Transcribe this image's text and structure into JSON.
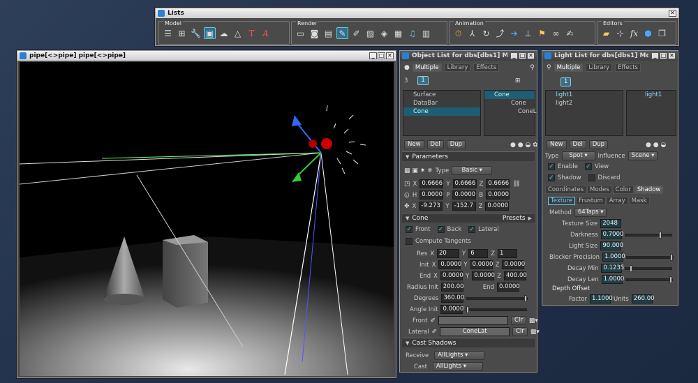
{
  "lists_window": {
    "title": "Lists",
    "close": "✕",
    "groups": [
      {
        "label": "Model",
        "icons": [
          "menu-icon",
          "hierarchy-icon",
          "wrench-icon",
          "cube-select-icon",
          "cloud-icon",
          "triangle-icon",
          "text-icon",
          "text-3d-icon"
        ]
      },
      {
        "label": "Render",
        "icons": [
          "display-icon",
          "camera-icon",
          "film-icon",
          "light-bulb-icon",
          "brush-icon",
          "texture-icon",
          "paint-icon",
          "shader-icon",
          "music-note-icon",
          "filmstrip-icon"
        ]
      },
      {
        "label": "Animation",
        "icons": [
          "stopwatch-icon",
          "axis-icon",
          "rotate-icon",
          "3d-arrow-icon",
          "play-arrow-icon",
          "ruler-icon",
          "flag-icon",
          "link-icon",
          "script-icon"
        ]
      },
      {
        "label": "Editors",
        "icons": [
          "folder-icon",
          "transform-icon",
          "fx-icon",
          "box-icon",
          "copy-icon"
        ]
      }
    ]
  },
  "viewport": {
    "title": "pipe[<>pipe] pipe[<>pipe]"
  },
  "object_list": {
    "title": "Object List for dbs[dbs1] Modifi...",
    "tabs": [
      "Multiple",
      "Library",
      "Effects"
    ],
    "count": "3",
    "index": "1",
    "objects": [
      "Surface",
      "DataBar",
      "Cone"
    ],
    "tree": [
      "Cone",
      "Cone",
      "ConeL"
    ],
    "buttons": [
      "New",
      "Del",
      "Dup"
    ],
    "params_label": "Parameters",
    "type_label": "Type",
    "type_value": "Basic",
    "scale": {
      "x": "0.6666",
      "y": "0.6666",
      "z": "0.6666"
    },
    "hpb": {
      "h": "0.0000",
      "p": "0.0000",
      "b": "0.0000"
    },
    "pos": {
      "x": "-9.273",
      "y": "-152.7",
      "z": "0.0000"
    },
    "cone_label": "Cone",
    "presets": "Presets",
    "front": "Front",
    "back": "Back",
    "lateral": "Lateral",
    "compute": "Compute Tangents",
    "res_label": "Res",
    "res": {
      "x": "20",
      "y": "6",
      "z": "1"
    },
    "init_label": "Init",
    "init": {
      "x": "0.0000",
      "y": "0.0000",
      "z": "0.0000"
    },
    "end_label": "End",
    "end": {
      "x": "0.0000",
      "y": "0.0000",
      "z": "400.00"
    },
    "radius_init_label": "Radius Init",
    "radius_init": "200.00",
    "radius_end_label": "End",
    "radius_end": "0.0000",
    "degrees_label": "Degrees",
    "degrees": "360.00",
    "angle_label": "Angle Init",
    "angle": "0.0000",
    "front_tex_label": "Front",
    "lateral_tex_label": "Lateral",
    "lateral_tex": "ConeLat",
    "clr": "Clr",
    "cast_shadows": "Cast Shadows",
    "receive_label": "Receive",
    "receive": "AllLights",
    "cast_label": "Cast",
    "cast": "AllLights"
  },
  "light_list": {
    "title": "Light List for dbs[dbs1] Modifi...",
    "tabs": [
      "Multiple",
      "Library",
      "Effects"
    ],
    "index": "1",
    "lights": [
      "light1",
      "light2"
    ],
    "tree": [
      "light1"
    ],
    "buttons": [
      "New",
      "Del",
      "Dup"
    ],
    "type_label": "Type",
    "type": "Spot",
    "influence_label": "Influence",
    "influence": "Scene",
    "enable": "Enable",
    "view": "View",
    "shadow": "Shadow",
    "discard": "Discard",
    "tabs2": [
      "Coordinates",
      "Modes",
      "Color",
      "Shadow"
    ],
    "tabs3": [
      "Texture",
      "Frustum",
      "Array",
      "Mask"
    ],
    "method_label": "Method",
    "method": "64Taps",
    "tex_size_label": "Texture Size",
    "tex_size": "2048",
    "darkness_label": "Darkness",
    "darkness": "0.7000",
    "light_size_label": "Light Size",
    "light_size": "90.000",
    "blocker_label": "Blocker Precision",
    "blocker": "1.0000",
    "decay_min_label": "Decay Min",
    "decay_min": "0.1235",
    "decay_len_label": "Decay Len",
    "decay_len": "1.0000",
    "depth_label": "Depth Offset",
    "factor_label": "Factor",
    "factor": "1.1000",
    "units_label": "Units",
    "units": "260.00"
  }
}
